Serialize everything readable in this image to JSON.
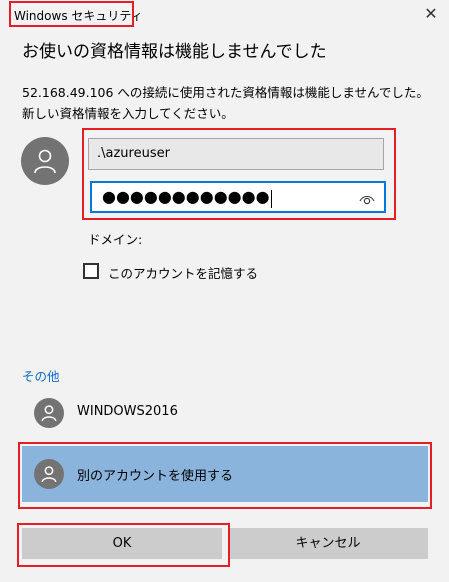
{
  "window": {
    "title": "Windows セキュリティ",
    "close_glyph": "✕"
  },
  "dialog": {
    "heading": "お使いの資格情報は機能しませんでした",
    "message_line1": "52.168.49.106 への接続に使用された資格情報は機能しませんでした。",
    "message_line2": "新しい資格情報を入力してください。",
    "username_value": ".\\azureuser",
    "password_mask": "●●●●●●●●●●●●",
    "domain_label": "ドメイン:",
    "remember_label": "このアカウントを記憶する",
    "remember_checked": false,
    "others_label": "その他",
    "accounts": [
      {
        "label": "WINDOWS2016",
        "selected": false
      },
      {
        "label": "別のアカウントを使用する",
        "selected": true
      }
    ]
  },
  "buttons": {
    "ok_label": "OK",
    "cancel_label": "キャンセル"
  },
  "colors": {
    "highlight": "#e31e24",
    "link_blue": "#0a6bc6",
    "selected_row": "#8ab4dc",
    "focus_border": "#0078d7"
  },
  "icons": {
    "close": "close-icon",
    "user": "user-avatar-icon",
    "reveal_password": "eye-icon"
  }
}
